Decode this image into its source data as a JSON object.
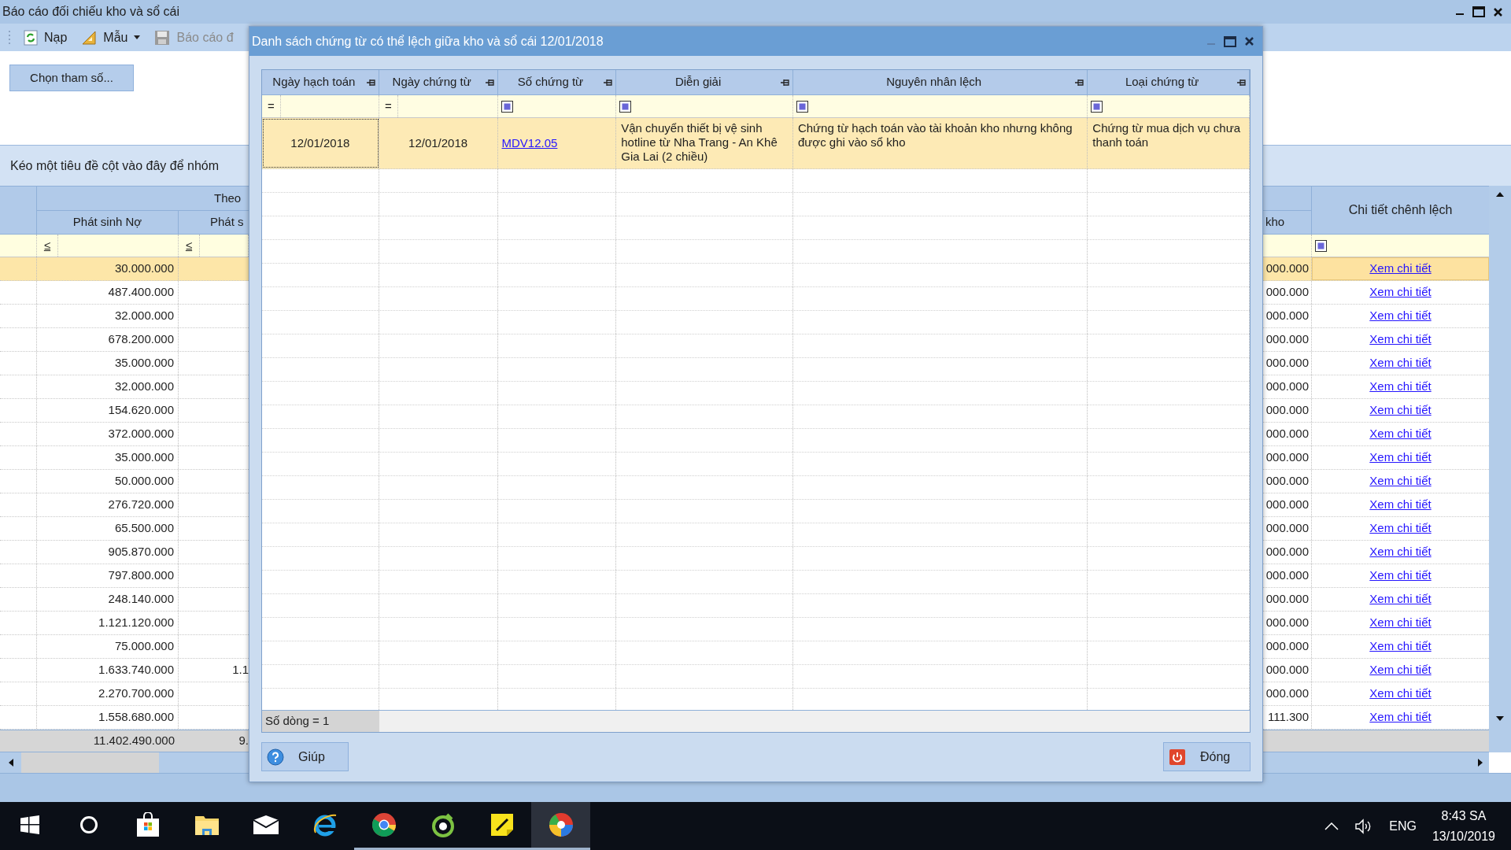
{
  "main_window": {
    "title": "Báo cáo đối chiếu kho và sổ cái",
    "toolbar": [
      {
        "kind": "refresh",
        "label": "Nạp",
        "disabled": false,
        "has_menu": false
      },
      {
        "kind": "template",
        "label": "Mẫu",
        "disabled": false,
        "has_menu": true
      },
      {
        "kind": "save",
        "label": "Báo cáo đ",
        "disabled": true,
        "has_menu": false
      }
    ],
    "params_button": "Chọn tham số...",
    "group_panel_hint": "Kéo một tiêu đề cột vào đây để nhóm",
    "grid": {
      "band_header": "Theo",
      "columns": [
        "Phát sinh Nợ",
        "Phát s",
        "kho",
        "Chi tiết chênh lệch"
      ],
      "filter_operators": [
        "≤",
        "≤"
      ],
      "rows": [
        {
          "debit": "30.000.000",
          "col2": "",
          "stock": "000.000",
          "link": "Xem chi tiết",
          "selected": true
        },
        {
          "debit": "487.400.000",
          "col2": "",
          "stock": "000.000",
          "link": "Xem chi tiết",
          "selected": false
        },
        {
          "debit": "32.000.000",
          "col2": "",
          "stock": "000.000",
          "link": "Xem chi tiết",
          "selected": false
        },
        {
          "debit": "678.200.000",
          "col2": "",
          "stock": "000.000",
          "link": "Xem chi tiết",
          "selected": false
        },
        {
          "debit": "35.000.000",
          "col2": "",
          "stock": "000.000",
          "link": "Xem chi tiết",
          "selected": false
        },
        {
          "debit": "32.000.000",
          "col2": "",
          "stock": "000.000",
          "link": "Xem chi tiết",
          "selected": false
        },
        {
          "debit": "154.620.000",
          "col2": "",
          "stock": "000.000",
          "link": "Xem chi tiết",
          "selected": false
        },
        {
          "debit": "372.000.000",
          "col2": "",
          "stock": "000.000",
          "link": "Xem chi tiết",
          "selected": false
        },
        {
          "debit": "35.000.000",
          "col2": "",
          "stock": "000.000",
          "link": "Xem chi tiết",
          "selected": false
        },
        {
          "debit": "50.000.000",
          "col2": "",
          "stock": "000.000",
          "link": "Xem chi tiết",
          "selected": false
        },
        {
          "debit": "276.720.000",
          "col2": "",
          "stock": "000.000",
          "link": "Xem chi tiết",
          "selected": false
        },
        {
          "debit": "65.500.000",
          "col2": "",
          "stock": "000.000",
          "link": "Xem chi tiết",
          "selected": false
        },
        {
          "debit": "905.870.000",
          "col2": "",
          "stock": "000.000",
          "link": "Xem chi tiết",
          "selected": false
        },
        {
          "debit": "797.800.000",
          "col2": "",
          "stock": "000.000",
          "link": "Xem chi tiết",
          "selected": false
        },
        {
          "debit": "248.140.000",
          "col2": "",
          "stock": "000.000",
          "link": "Xem chi tiết",
          "selected": false
        },
        {
          "debit": "1.121.120.000",
          "col2": "",
          "stock": "000.000",
          "link": "Xem chi tiết",
          "selected": false
        },
        {
          "debit": "75.000.000",
          "col2": "",
          "stock": "000.000",
          "link": "Xem chi tiết",
          "selected": false
        },
        {
          "debit": "1.633.740.000",
          "col2": "1.1",
          "stock": "000.000",
          "link": "Xem chi tiết",
          "selected": false
        },
        {
          "debit": "2.270.700.000",
          "col2": "",
          "stock": "000.000",
          "link": "Xem chi tiết",
          "selected": false
        },
        {
          "debit": "1.558.680.000",
          "col2": "",
          "stock": "111.300",
          "link": "Xem chi tiết",
          "selected": false
        }
      ],
      "totals": [
        "11.402.490.000",
        "9."
      ]
    }
  },
  "dialog": {
    "title": "Danh sách chứng từ có thể lệch giữa kho và sổ cái 12/01/2018",
    "columns": [
      "Ngày hạch toán",
      "Ngày chứng từ",
      "Số chứng từ",
      "Diễn giải",
      "Nguyên nhân lệch",
      "Loại chứng từ"
    ],
    "filters": [
      {
        "kind": "operator",
        "text": "="
      },
      {
        "kind": "operator",
        "text": "="
      },
      {
        "kind": "checkbox"
      },
      {
        "kind": "checkbox"
      },
      {
        "kind": "checkbox"
      },
      {
        "kind": "checkbox"
      }
    ],
    "rows": [
      {
        "selected": true,
        "cells": [
          {
            "kind": "date",
            "text": "12/01/2018"
          },
          {
            "kind": "date",
            "text": "12/01/2018"
          },
          {
            "kind": "link",
            "text": "MDV12.05"
          },
          {
            "kind": "text",
            "text": "Vận chuyển thiết bị vệ sinh hotline từ Nha Trang - An Khê Gia Lai (2 chiều)"
          },
          {
            "kind": "text",
            "text": "Chứng từ hạch toán vào tài khoản kho nhưng không được ghi vào sổ kho"
          },
          {
            "kind": "text",
            "text": "Chứng từ mua dịch vụ chưa thanh toán"
          }
        ]
      }
    ],
    "row_count": "Số dòng = 1",
    "buttons": [
      {
        "kind": "help",
        "label": "Giúp"
      },
      {
        "kind": "close",
        "label": "Đóng"
      }
    ]
  },
  "taskbar": {
    "apps": [
      {
        "kind": "start",
        "running": false,
        "active": false
      },
      {
        "kind": "search",
        "running": false,
        "active": false
      },
      {
        "kind": "store",
        "running": false,
        "active": false
      },
      {
        "kind": "explorer",
        "running": false,
        "active": false
      },
      {
        "kind": "mail",
        "running": false,
        "active": false
      },
      {
        "kind": "ie",
        "running": false,
        "active": false
      },
      {
        "kind": "chrome",
        "running": true,
        "active": false
      },
      {
        "kind": "green",
        "running": true,
        "active": false
      },
      {
        "kind": "notes",
        "running": true,
        "active": false
      },
      {
        "kind": "app",
        "running": true,
        "active": true
      }
    ],
    "language": "ENG",
    "time": "8:43 SA",
    "date": "13/10/2019"
  }
}
